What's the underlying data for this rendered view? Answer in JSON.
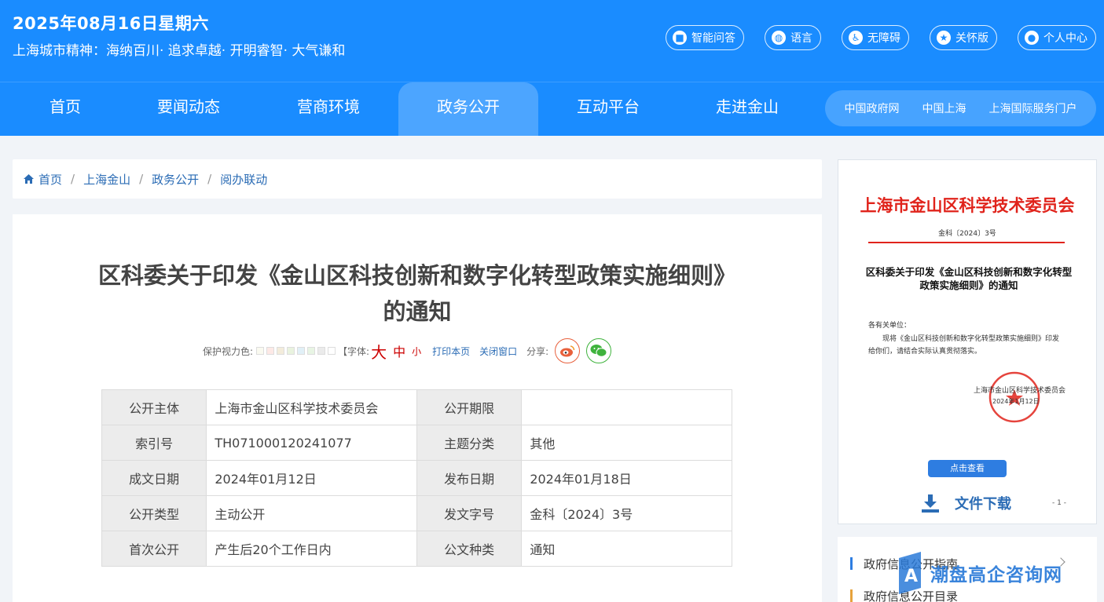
{
  "header": {
    "date": "2025年08月16日星期六",
    "motto": "上海城市精神：海纳百川· 追求卓越· 开明睿智· 大气谦和",
    "buttons": [
      {
        "label": "智能问答",
        "icon": "robot-icon"
      },
      {
        "label": "语言",
        "icon": "globe-icon"
      },
      {
        "label": "无障碍",
        "icon": "accessibility-icon"
      },
      {
        "label": "关怀版",
        "icon": "thumbs-up-icon"
      },
      {
        "label": "个人中心",
        "icon": "user-icon"
      }
    ]
  },
  "nav": {
    "items": [
      "首页",
      "要闻动态",
      "营商环境",
      "政务公开",
      "互动平台",
      "走进金山"
    ],
    "active": "政务公开",
    "links": [
      "中国政府网",
      "中国上海",
      "上海国际服务门户"
    ]
  },
  "breadcrumb": [
    "首页",
    "上海金山",
    "政务公开",
    "阅办联动"
  ],
  "article": {
    "title": "区科委关于印发《金山区科技创新和数字化转型政策实施细则》的通知",
    "tools": {
      "eye_label": "保护视力色:",
      "swatches": [
        "#fafaf0",
        "#fde9e6",
        "#f3ecdb",
        "#e9f3df",
        "#e1f0f7",
        "#e8f5e4",
        "#ebebeb",
        "#ffffff"
      ],
      "font_label": "【字体:",
      "font_big": "大",
      "font_mid": "中",
      "font_small": "小",
      "close_bracket": "】",
      "print": "打印本页",
      "close": "关闭窗口",
      "share": "分享:"
    },
    "meta": [
      [
        {
          "k": "公开主体",
          "v": "上海市金山区科学技术委员会"
        },
        {
          "k": "公开期限",
          "v": ""
        }
      ],
      [
        {
          "k": "索引号",
          "v": "TH071000120241077"
        },
        {
          "k": "主题分类",
          "v": "其他"
        }
      ],
      [
        {
          "k": "成文日期",
          "v": "2024年01月12日"
        },
        {
          "k": "发布日期",
          "v": "2024年01月18日"
        }
      ],
      [
        {
          "k": "公开类型",
          "v": "主动公开"
        },
        {
          "k": "发文字号",
          "v": "金科〔2024〕3号"
        }
      ],
      [
        {
          "k": "首次公开",
          "v": "产生后20个工作日内"
        },
        {
          "k": "公文种类",
          "v": "通知"
        }
      ]
    ]
  },
  "document_preview": {
    "org": "上海市金山区科学技术委员会",
    "number": "金科〔2024〕3号",
    "title": "区科委关于印发《金山区科技创新和数字化转型政策实施细则》的通知",
    "greeting": "各有关单位：",
    "body": "现将《金山区科技创新和数字化转型政策实施细则》印发给你们，请结合实际认真贯彻落实。",
    "signer": "上海市金山区科学技术委员会",
    "sign_date": "2024年1月12日",
    "seal_text": "上海市金山区科学技术委员会",
    "view_button": "点击查看",
    "download": "文件下载",
    "page": "- 1 -"
  },
  "side_links": [
    {
      "label": "政府信息公开指南",
      "color": "#2e7de1"
    },
    {
      "label": "政府信息公开目录",
      "color": "#e6a23c"
    }
  ],
  "watermark": "潮盘高企咨询网"
}
